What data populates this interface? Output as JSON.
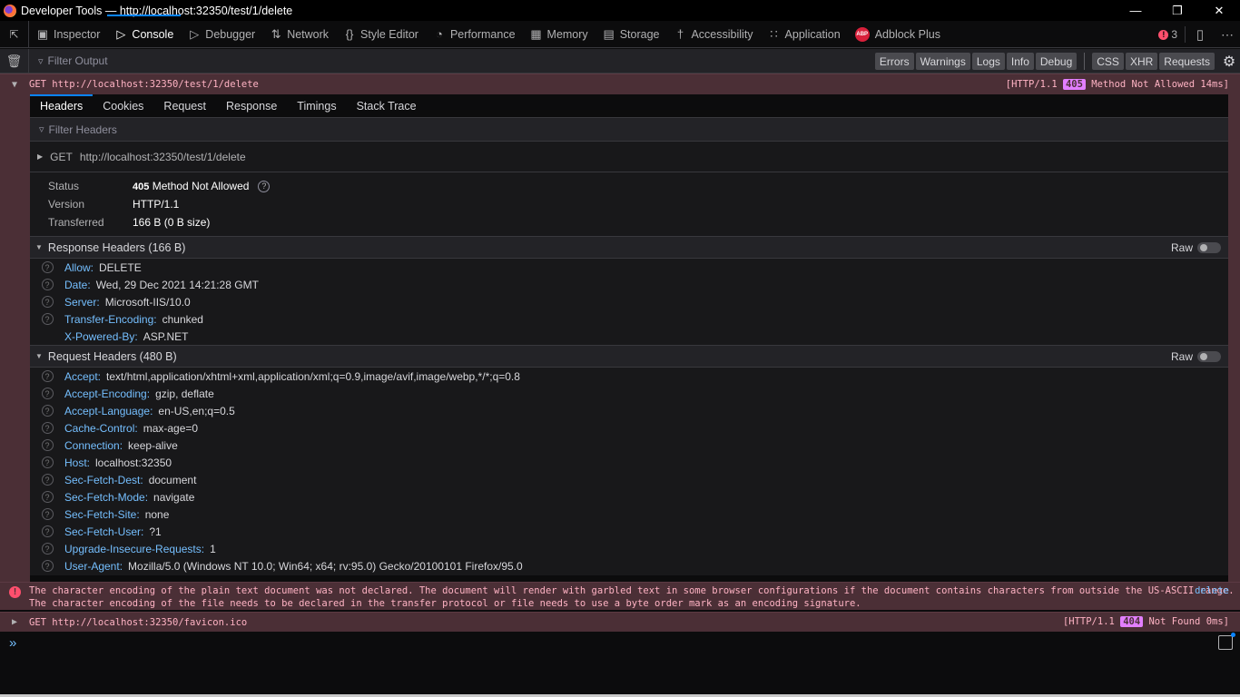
{
  "window": {
    "title": "Developer Tools — http://localhost:32350/test/1/delete",
    "controls": [
      "minimize",
      "restore",
      "close"
    ]
  },
  "toolbox": {
    "tabs": [
      {
        "label": "Inspector",
        "icon": "inspector-icon"
      },
      {
        "label": "Console",
        "icon": "console-icon",
        "active": true
      },
      {
        "label": "Debugger",
        "icon": "debugger-icon"
      },
      {
        "label": "Network",
        "icon": "network-icon"
      },
      {
        "label": "Style Editor",
        "icon": "style-editor-icon"
      },
      {
        "label": "Performance",
        "icon": "performance-icon"
      },
      {
        "label": "Memory",
        "icon": "memory-icon"
      },
      {
        "label": "Storage",
        "icon": "storage-icon"
      },
      {
        "label": "Accessibility",
        "icon": "accessibility-icon"
      },
      {
        "label": "Application",
        "icon": "application-icon"
      },
      {
        "label": "Adblock Plus",
        "icon": "abp-icon"
      }
    ],
    "abp_icon_text": "ABP",
    "error_count": "3"
  },
  "console_filter": {
    "placeholder": "Filter Output",
    "buttons": [
      "Errors",
      "Warnings",
      "Logs",
      "Info",
      "Debug"
    ],
    "buttons2": [
      "CSS",
      "XHR",
      "Requests"
    ]
  },
  "request1": {
    "method_url": "GET http://localhost:32350/test/1/delete",
    "http_version": "[HTTP/1.1",
    "status_code": "405",
    "status_rest": "Method Not Allowed 14ms]"
  },
  "details": {
    "tabs": [
      "Headers",
      "Cookies",
      "Request",
      "Response",
      "Timings",
      "Stack Trace"
    ],
    "filter_placeholder": "Filter Headers",
    "summary_method": "GET",
    "summary_url": "http://localhost:32350/test/1/delete",
    "status_label": "Status",
    "status_code": "405",
    "status_text": "Method Not Allowed",
    "version_label": "Version",
    "version_value": "HTTP/1.1",
    "transferred_label": "Transferred",
    "transferred_value": "166 B (0 B size)",
    "raw_label": "Raw",
    "response_headers_title": "Response Headers (166 B)",
    "response_headers": [
      {
        "name": "Allow:",
        "value": "DELETE",
        "help": true
      },
      {
        "name": "Date:",
        "value": "Wed, 29 Dec 2021 14:21:28 GMT",
        "help": true
      },
      {
        "name": "Server:",
        "value": "Microsoft-IIS/10.0",
        "help": true
      },
      {
        "name": "Transfer-Encoding:",
        "value": "chunked",
        "help": true
      },
      {
        "name": "X-Powered-By:",
        "value": "ASP.NET",
        "help": false
      }
    ],
    "request_headers_title": "Request Headers (480 B)",
    "request_headers": [
      {
        "name": "Accept:",
        "value": "text/html,application/xhtml+xml,application/xml;q=0.9,image/avif,image/webp,*/*;q=0.8"
      },
      {
        "name": "Accept-Encoding:",
        "value": "gzip, deflate"
      },
      {
        "name": "Accept-Language:",
        "value": "en-US,en;q=0.5"
      },
      {
        "name": "Cache-Control:",
        "value": "max-age=0"
      },
      {
        "name": "Connection:",
        "value": "keep-alive"
      },
      {
        "name": "Host:",
        "value": "localhost:32350"
      },
      {
        "name": "Sec-Fetch-Dest:",
        "value": "document"
      },
      {
        "name": "Sec-Fetch-Mode:",
        "value": "navigate"
      },
      {
        "name": "Sec-Fetch-Site:",
        "value": "none"
      },
      {
        "name": "Sec-Fetch-User:",
        "value": "?1"
      },
      {
        "name": "Upgrade-Insecure-Requests:",
        "value": "1"
      },
      {
        "name": "User-Agent:",
        "value": "Mozilla/5.0 (Windows NT 10.0; Win64; x64; rv:95.0) Gecko/20100101 Firefox/95.0"
      }
    ]
  },
  "error_message": {
    "line1": "The character encoding of the plain text document was not declared. The document will render with garbled text in some browser configurations if the document contains characters from outside the US-ASCII range.",
    "line2": "The character encoding of the file needs to be declared in the transfer protocol or file needs to use a byte order mark as an encoding signature.",
    "source": "delete"
  },
  "request2": {
    "method_url": "GET http://localhost:32350/favicon.ico",
    "http_version": "[HTTP/1.1",
    "status_code": "404",
    "status_rest": "Not Found 0ms]"
  },
  "colors": {
    "accent": "#0a84ff",
    "error_bg": "#4b2f36",
    "status_badge": "#e27fff",
    "header_name": "#75bfff"
  }
}
